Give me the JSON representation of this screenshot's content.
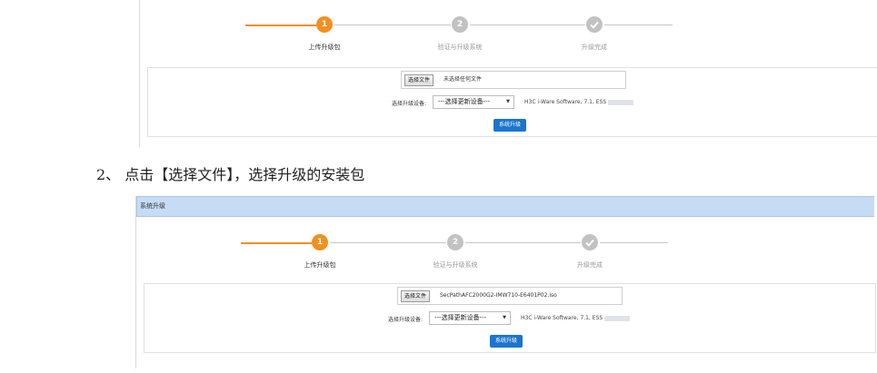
{
  "top_panel": {
    "steps": [
      {
        "number": "1",
        "label": "上传升级包"
      },
      {
        "number": "2",
        "label": "验证与升级系统"
      },
      {
        "icon": "check-icon",
        "label": "升级完成"
      }
    ],
    "file_button": "选择文件",
    "file_name": "未选择任何文件",
    "device_label": "选择升级设备:",
    "device_select": "---选择更新设备---",
    "device_info": "H3C i-Ware Software, 7.1, ESS",
    "upgrade_button": "系统升级"
  },
  "instruction": "2、 点击【选择文件】，选择升级的安装包",
  "bottom_panel": {
    "header_title": "系统升级",
    "steps": [
      {
        "number": "1",
        "label": "上传升级包"
      },
      {
        "number": "2",
        "label": "验证与升级系统"
      },
      {
        "icon": "check-icon",
        "label": "升级完成"
      }
    ],
    "file_button": "选择文件",
    "file_name": "SecPathAFC2000G2-IMW710-E6401P02.iso",
    "device_label": "选择升级设备:",
    "device_select": "---选择更新设备---",
    "device_info": "H3C i-Ware Software, 7.1, ESS",
    "upgrade_button": "系统升级"
  },
  "colors": {
    "accent": "#f2901f",
    "primary_button": "#1a75cf",
    "header_bg": "#c6dcf5",
    "inactive": "#c2c2c2"
  }
}
